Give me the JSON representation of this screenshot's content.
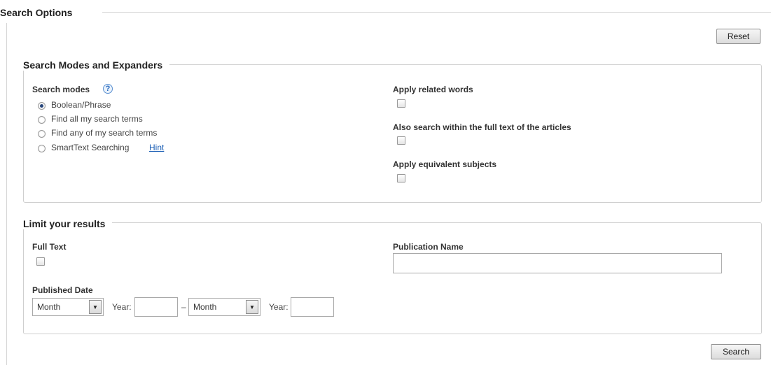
{
  "title": "Search Options",
  "reset_label": "Reset",
  "search_label": "Search",
  "modes_section": {
    "title": "Search Modes and Expanders",
    "search_modes_label": "Search modes",
    "help_glyph": "?",
    "modes": [
      "Boolean/Phrase",
      "Find all my search terms",
      "Find any of my search terms",
      "SmartText Searching"
    ],
    "selected_mode": "Boolean/Phrase",
    "hint_link": "Hint",
    "expanders": [
      {
        "label": "Apply related words",
        "checked": false
      },
      {
        "label": "Also search within the full text of the articles",
        "checked": false
      },
      {
        "label": "Apply equivalent subjects",
        "checked": false
      }
    ]
  },
  "limits_section": {
    "title": "Limit your results",
    "full_text_label": "Full Text",
    "full_text_checked": false,
    "publication_name_label": "Publication Name",
    "publication_name_value": "",
    "published_date_label": "Published Date",
    "from_month": "Month",
    "from_year_label": "Year:",
    "from_year_value": "",
    "range_dash": "–",
    "to_month": "Month",
    "to_year_label": "Year:",
    "to_year_value": ""
  }
}
